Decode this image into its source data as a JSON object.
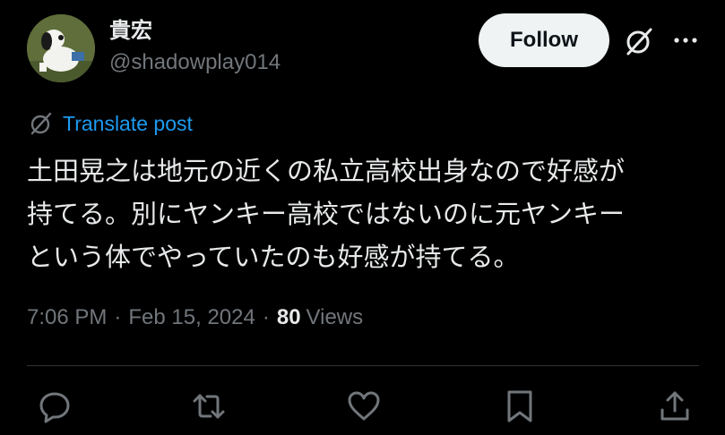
{
  "user": {
    "display_name": "貴宏",
    "handle": "@shadowplay014",
    "avatar_icon": "snoopy-avatar"
  },
  "buttons": {
    "follow_label": "Follow",
    "grok_icon": "grok-icon",
    "more_icon": "more-icon"
  },
  "translate": {
    "label": "Translate post",
    "icon": "translate-icon"
  },
  "post": {
    "lines": [
      "土田晃之は地元の近くの私立高校出身なので好感が",
      "持てる。別にヤンキー高校ではないのに元ヤンキー",
      "という体でやっていたのも好感が持てる。"
    ]
  },
  "meta": {
    "time": "7:06 PM",
    "separator": "·",
    "date": "Feb 15, 2024",
    "views_count": "80",
    "views_label": "Views"
  },
  "actions": [
    {
      "icon": "reply-icon"
    },
    {
      "icon": "repost-icon"
    },
    {
      "icon": "like-icon"
    },
    {
      "icon": "bookmark-icon"
    },
    {
      "icon": "share-icon"
    }
  ],
  "colors": {
    "background": "#000000",
    "text": "#e7e9ea",
    "muted": "#71767b",
    "link": "#1d9bf0",
    "button_bg": "#eff3f4",
    "divider": "#2f3336"
  }
}
